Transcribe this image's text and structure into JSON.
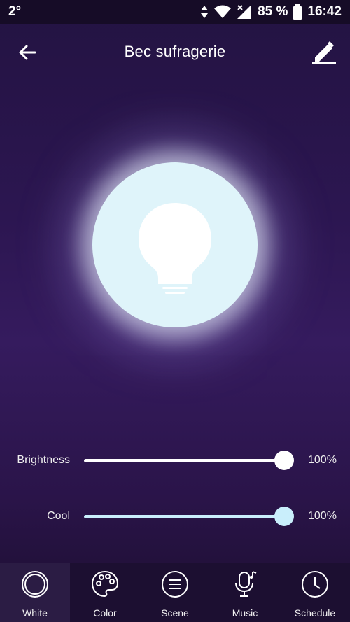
{
  "status_bar": {
    "temperature": "2°",
    "battery": "85 %",
    "time": "16:42"
  },
  "header": {
    "title": "Bec sufragerie"
  },
  "colors": {
    "bulb_fill": "#dff4fa",
    "slider_white": "#ffffff",
    "slider_cool": "#c9eefb",
    "active_tab_bg": "#2b1c44"
  },
  "sliders": [
    {
      "label": "Brightness",
      "value_text": "100%",
      "value": 100
    },
    {
      "label": "Cool",
      "value_text": "100%",
      "value": 100
    }
  ],
  "nav": {
    "items": [
      {
        "label": "White",
        "icon": "ring-icon",
        "active": true
      },
      {
        "label": "Color",
        "icon": "palette-icon",
        "active": false
      },
      {
        "label": "Scene",
        "icon": "menu-circle-icon",
        "active": false
      },
      {
        "label": "Music",
        "icon": "microphone-note-icon",
        "active": false
      },
      {
        "label": "Schedule",
        "icon": "clock-icon",
        "active": false
      }
    ]
  }
}
